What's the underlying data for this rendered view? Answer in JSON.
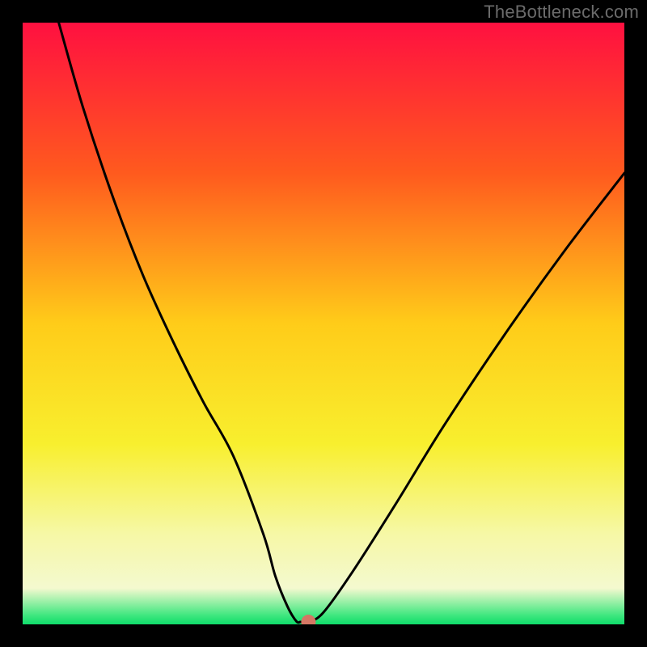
{
  "watermark": "TheBottleneck.com",
  "chart_data": {
    "type": "line",
    "title": "",
    "xlabel": "",
    "ylabel": "",
    "xlim": [
      0,
      100
    ],
    "ylim": [
      0,
      100
    ],
    "grid": false,
    "legend": false,
    "background_gradient": {
      "stops": [
        {
          "offset": 0.0,
          "color": "#ff1040"
        },
        {
          "offset": 0.25,
          "color": "#ff5a1e"
        },
        {
          "offset": 0.5,
          "color": "#ffcc19"
        },
        {
          "offset": 0.7,
          "color": "#f8ef2e"
        },
        {
          "offset": 0.85,
          "color": "#f6f8a6"
        },
        {
          "offset": 0.94,
          "color": "#f4f9cf"
        },
        {
          "offset": 0.985,
          "color": "#3fe77f"
        },
        {
          "offset": 1.0,
          "color": "#0fdc6a"
        }
      ]
    },
    "series": [
      {
        "name": "bottleneck-curve",
        "color": "#000000",
        "x": [
          6,
          10,
          15,
          20,
          25,
          30,
          35,
          40,
          42,
          44,
          45.5,
          46.2,
          47.5,
          50,
          55,
          62,
          70,
          80,
          90,
          100
        ],
        "y": [
          100,
          86,
          71,
          58,
          47,
          37,
          28,
          15,
          8,
          3,
          0.5,
          0.4,
          0.4,
          2,
          9,
          20,
          33,
          48,
          62,
          75
        ]
      }
    ],
    "marker": {
      "name": "selected-point",
      "x": 47.5,
      "y": 0.4,
      "color": "#d47764",
      "radius_px": 9
    }
  }
}
